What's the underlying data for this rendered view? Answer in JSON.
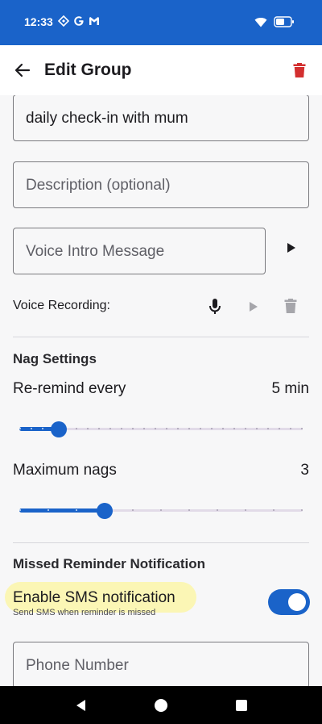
{
  "status_bar": {
    "time": "12:33"
  },
  "app_bar": {
    "title": "Edit Group"
  },
  "form": {
    "group_name_value": "daily check-in with mum",
    "description_placeholder": "Description (optional)",
    "voice_intro_placeholder": "Voice Intro Message",
    "voice_recording_label": "Voice Recording:",
    "phone_placeholder": "Phone Number"
  },
  "nag_settings": {
    "title": "Nag Settings",
    "reremind_label": "Re-remind every",
    "reremind_value": "5 min",
    "reremind_level": 0.14,
    "max_nags_label": "Maximum nags",
    "max_nags_value": "3",
    "max_nags_level": 0.3
  },
  "missed_notification": {
    "title": "Missed Reminder Notification",
    "sms_label": "Enable SMS notification",
    "sms_sublabel": "Send SMS when reminder is missed",
    "sms_enabled": true
  },
  "colors": {
    "primary": "#1a63c9",
    "delete": "#d32f2f",
    "highlight": "#fbf6b5"
  },
  "icons": [
    "back-arrow-icon",
    "trash-icon",
    "play-icon",
    "mic-icon"
  ]
}
